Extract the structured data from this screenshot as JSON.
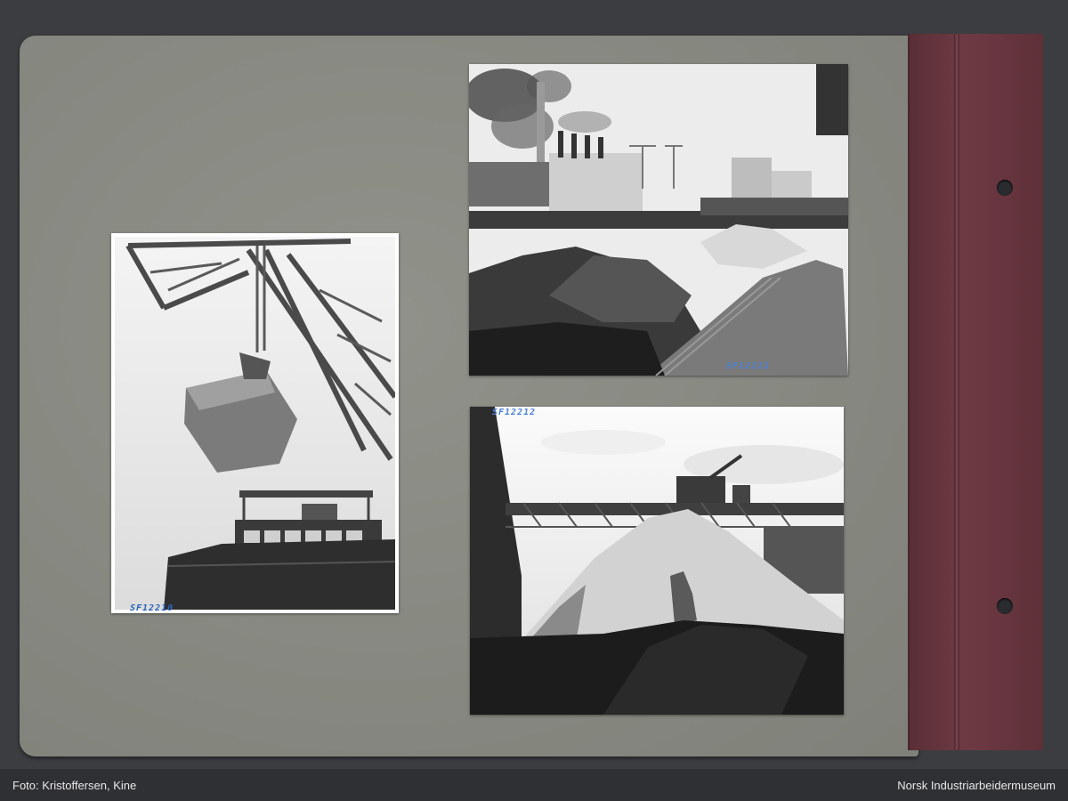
{
  "photos": [
    {
      "catalog_number": "SF12210"
    },
    {
      "catalog_number": "SF12211"
    },
    {
      "catalog_number": "SF12212"
    }
  ],
  "footer": {
    "credit": "Foto: Kristoffersen, Kine",
    "institution": "Norsk Industriarbeidermuseum"
  }
}
